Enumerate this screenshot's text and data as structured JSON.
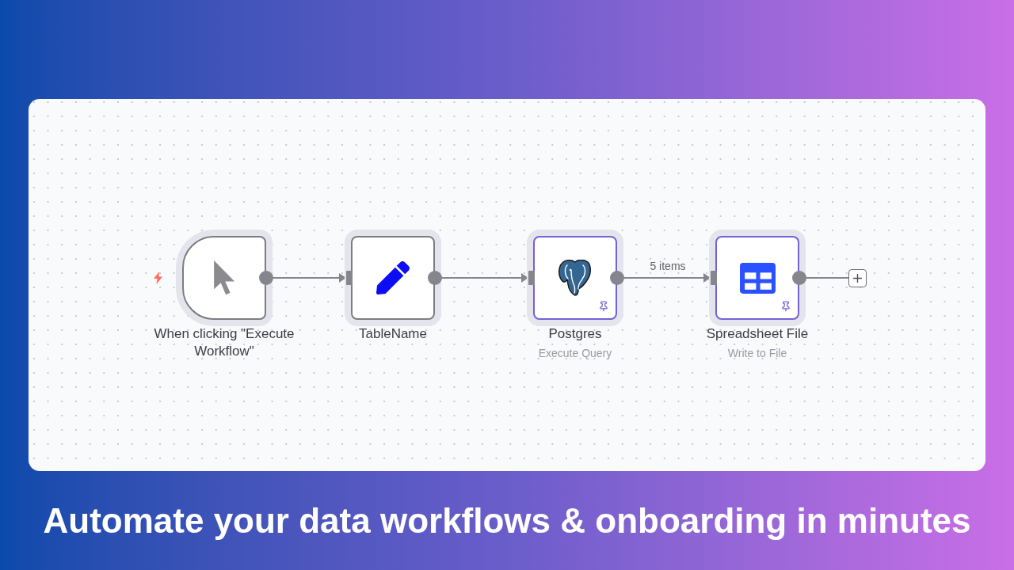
{
  "canvas": {
    "nodes": [
      {
        "kind": "trigger",
        "title": "When clicking \"Execute Workflow\"",
        "pinned": false
      },
      {
        "kind": "set",
        "title": "TableName",
        "pinned": false
      },
      {
        "kind": "postgres",
        "title": "Postgres",
        "subtitle": "Execute Query",
        "pinned": true,
        "output_label": "5 items"
      },
      {
        "kind": "spreadsheet",
        "title": "Spreadsheet File",
        "subtitle": "Write to File",
        "pinned": true
      }
    ]
  },
  "headline": "Automate your data workflows & onboarding in minutes"
}
